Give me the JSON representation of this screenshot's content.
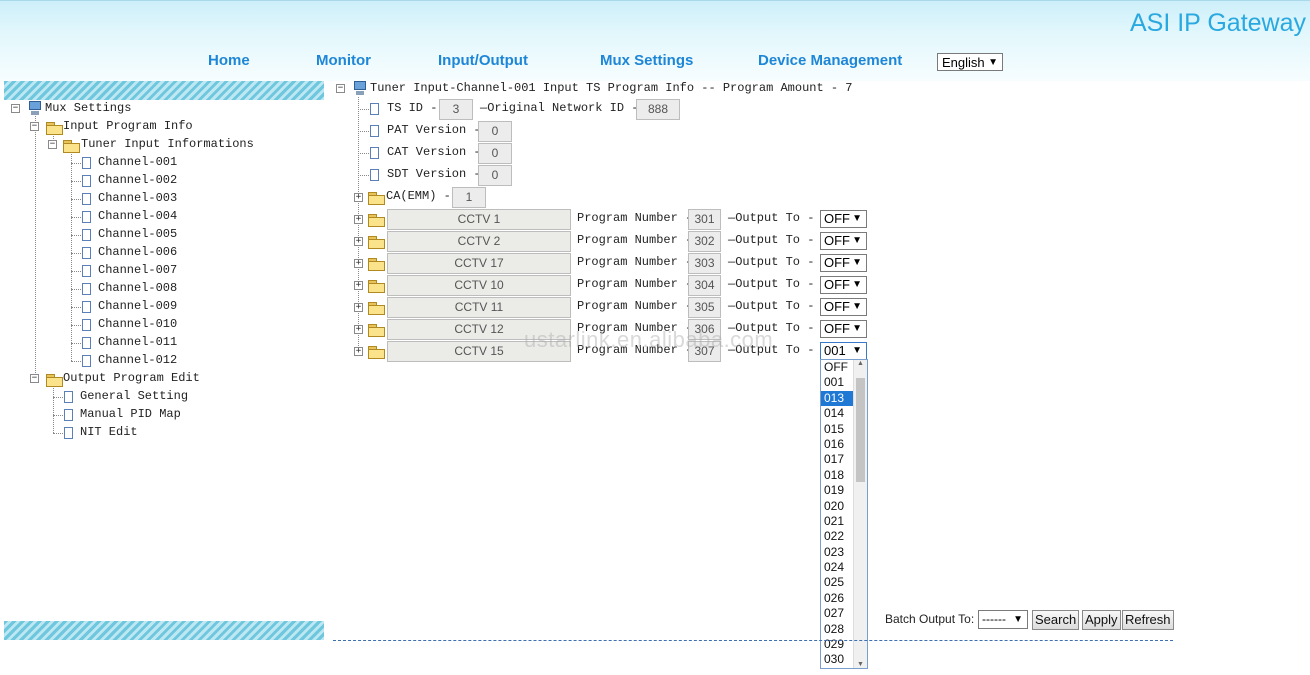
{
  "app_title": "ASI IP Gateway",
  "nav": [
    "Home",
    "Monitor",
    "Input/Output",
    "Mux Settings",
    "Device Management"
  ],
  "language": "English",
  "sidebar": {
    "root": "Mux Settings",
    "input_program_info": "Input Program Info",
    "tuner_input": "Tuner Input Informations",
    "channels": [
      "Channel-001",
      "Channel-002",
      "Channel-003",
      "Channel-004",
      "Channel-005",
      "Channel-006",
      "Channel-007",
      "Channel-008",
      "Channel-009",
      "Channel-010",
      "Channel-011",
      "Channel-012"
    ],
    "output_program_edit": "Output Program Edit",
    "output_items": [
      "General Setting",
      "Manual PID Map",
      "NIT Edit"
    ]
  },
  "main": {
    "header": "Tuner Input-Channel-001 Input TS Program Info -- Program Amount - 7",
    "ts_id_label": "TS ID -",
    "ts_id": "3",
    "onid_label": "—Original Network ID -",
    "onid": "888",
    "pat_label": "PAT Version -",
    "pat": "0",
    "cat_label": "CAT Version -",
    "cat": "0",
    "sdt_label": "SDT Version -",
    "sdt": "0",
    "ca_label": "CA(EMM) -",
    "ca": "1",
    "program_number_label": "Program Number -",
    "output_to_label": "—Output To -",
    "programs": [
      {
        "name": "CCTV 1",
        "number": "301",
        "output": "OFF"
      },
      {
        "name": "CCTV 2",
        "number": "302",
        "output": "OFF"
      },
      {
        "name": "CCTV 17",
        "number": "303",
        "output": "OFF"
      },
      {
        "name": "CCTV 10",
        "number": "304",
        "output": "OFF"
      },
      {
        "name": "CCTV 11",
        "number": "305",
        "output": "OFF"
      },
      {
        "name": "CCTV 12",
        "number": "306",
        "output": "OFF"
      },
      {
        "name": "CCTV 15",
        "number": "307",
        "output": "001"
      }
    ],
    "dropdown_options": [
      "OFF",
      "001",
      "013",
      "014",
      "015",
      "016",
      "017",
      "018",
      "019",
      "020",
      "021",
      "022",
      "023",
      "024",
      "025",
      "026",
      "027",
      "028",
      "029",
      "030"
    ],
    "dropdown_selected": "013"
  },
  "footer": {
    "batch_label": "Batch Output To:",
    "batch_value": "------",
    "search": "Search",
    "apply": "Apply",
    "refresh": "Refresh"
  },
  "watermark": "ustarlink.en.alibaba.com"
}
